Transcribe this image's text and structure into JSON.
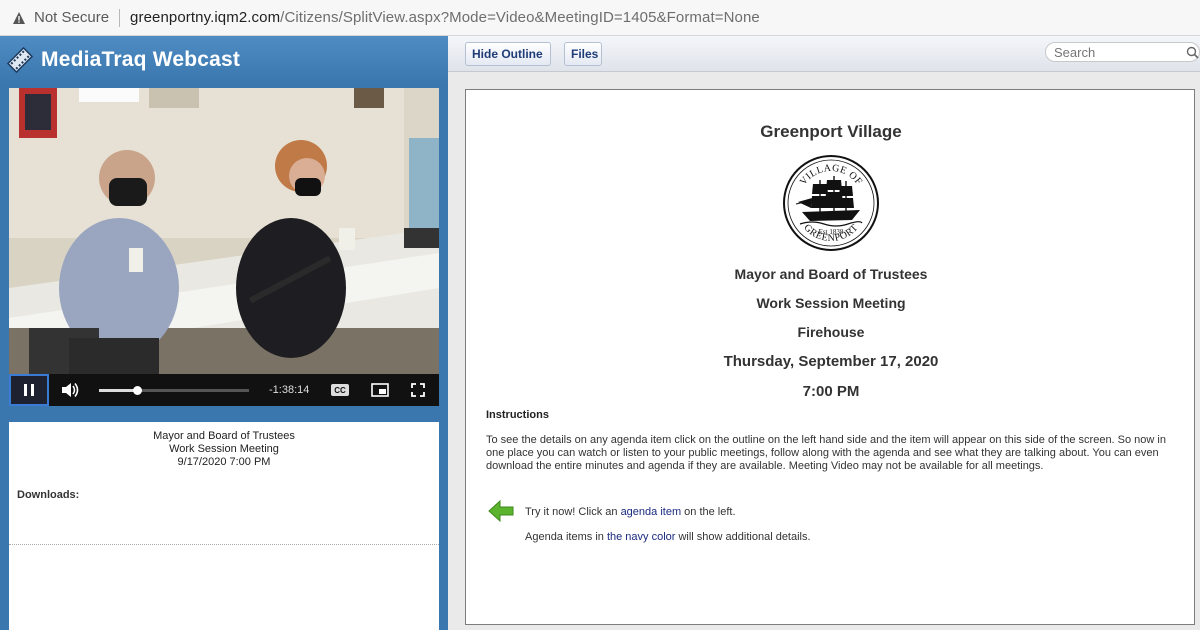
{
  "browser": {
    "security_label": "Not Secure",
    "url_host": "greenportny.iqm2.com",
    "url_path": "/Citizens/SplitView.aspx?Mode=Video&MeetingID=1405&Format=None"
  },
  "player": {
    "brand": "MediaTraq Webcast",
    "time_remaining": "-1:38:14",
    "progress_fraction": 0.25,
    "cc_label": "CC"
  },
  "meeting_info": {
    "line1": "Mayor and Board of Trustees",
    "line2": "Work Session Meeting",
    "line3": "9/17/2020 7:00 PM",
    "downloads_label": "Downloads:"
  },
  "toolbar": {
    "hide_outline": "Hide Outline",
    "files": "Files",
    "search_placeholder": "Search"
  },
  "document": {
    "title": "Greenport Village",
    "seal_text_top": "VILLAGE OF",
    "seal_text_bottom": "GREENPORT",
    "seal_est": "Est 1838",
    "board": "Mayor and Board of Trustees",
    "meeting_type": "Work Session Meeting",
    "location": "Firehouse",
    "date": "Thursday, September 17, 2020",
    "time": "7:00 PM",
    "instructions_heading": "Instructions",
    "instructions_text": "To see the details on any agenda item click on the outline on the left hand side and the item will appear on this side of the screen. So now in one place you can watch or listen to your public meetings, follow along with the agenda and see what they are talking about. You can even download the entire minutes and agenda if they are available. Meeting Video may not be available for all meetings.",
    "try_prefix": "Try it now! Click an ",
    "try_link": "agenda item",
    "try_suffix": " on the left.",
    "note_prefix": "Agenda items in ",
    "note_link": "the navy color",
    "note_suffix": " will show additional details."
  },
  "colors": {
    "brand_blue": "#3a77ae",
    "navy": "#1a2a80",
    "arrow_green": "#5cb32e"
  }
}
